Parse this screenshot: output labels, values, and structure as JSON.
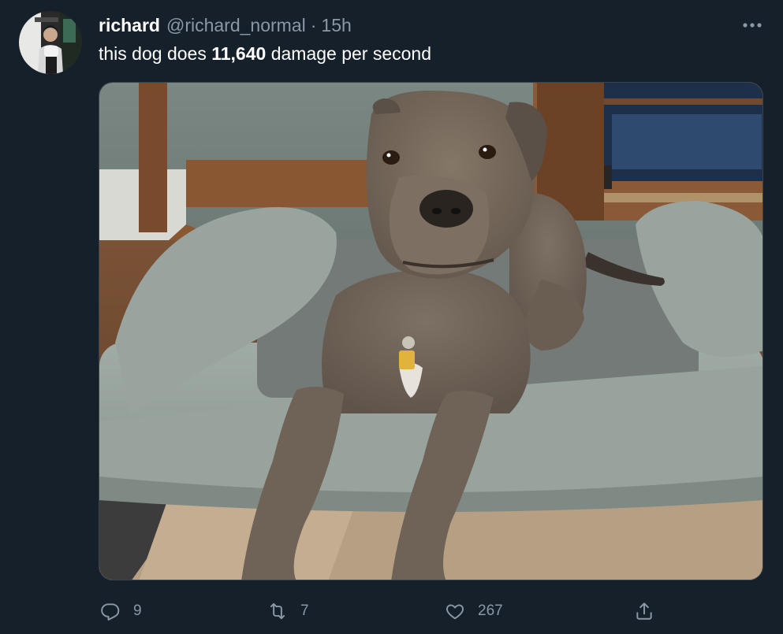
{
  "tweet": {
    "author": {
      "display_name": "richard",
      "handle": "@richard_normal",
      "separator": "·",
      "timestamp": "15h"
    },
    "text_before": "this dog does ",
    "text_bold": "11,640",
    "text_after": " damage per second",
    "media": {
      "subject": "dog-on-bed-photo"
    },
    "actions": {
      "reply_count": "9",
      "retweet_count": "7",
      "like_count": "267"
    },
    "icons": {
      "more": "more-icon",
      "reply": "reply-icon",
      "retweet": "retweet-icon",
      "like": "like-icon",
      "share": "share-icon"
    }
  },
  "theme": {
    "background": "#15202b",
    "text_primary": "#ffffff",
    "text_secondary": "#8b98a5",
    "border": "#38444d"
  }
}
